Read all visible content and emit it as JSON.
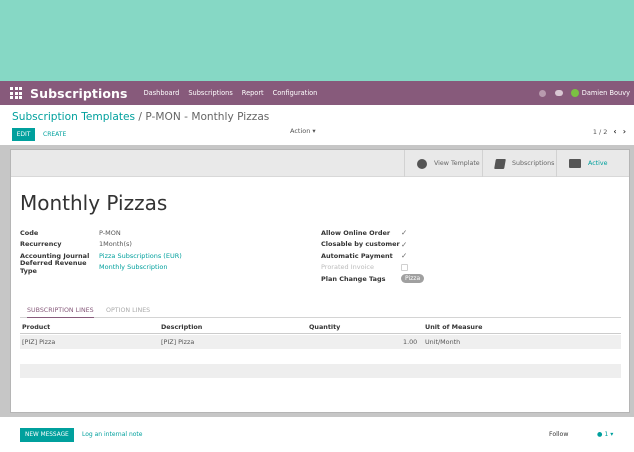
{
  "navbar": {
    "brand": "Subscriptions",
    "menu": [
      "Dashboard",
      "Subscriptions",
      "Report",
      "Configuration"
    ],
    "user": "Damien Bouvy",
    "icons": [
      "apps-icon",
      "clock-icon",
      "chat-icon",
      "avatar"
    ],
    "color": "#875a7b"
  },
  "control_panel": {
    "breadcrumb_parent": "Subscription Templates",
    "breadcrumb_sep": " / ",
    "breadcrumb_current": "P-MON - Monthly Pizzas",
    "edit_label": "EDIT",
    "create_label": "CREATE",
    "action_label": "Action ▾",
    "pager": "1 / 2",
    "prev": "‹",
    "next": "›"
  },
  "smart_buttons": {
    "view_template": "View Template",
    "subscriptions": "Subscriptions",
    "active": "Active"
  },
  "form": {
    "title": "Monthly Pizzas",
    "left_fields": [
      {
        "label": "Code",
        "value": "P-MON"
      },
      {
        "label": "Recurrency",
        "value": "1Month(s)"
      },
      {
        "label": "Accounting Journal",
        "value": "Pizza Subscriptions (EUR)"
      },
      {
        "label": "Deferred Revenue Type",
        "value": "Monthly Subscription"
      }
    ],
    "right_fields": {
      "allow_online_order": "Allow Online Order",
      "closable_by_customer": "Closable by customer",
      "automatic_payment": "Automatic Payment",
      "prorated_invoice": "Prorated Invoice",
      "plan_change_tags": "Plan Change Tags",
      "tag": "Pizza"
    }
  },
  "tabs": {
    "lines": "SUBSCRIPTION LINES",
    "options": "OPTION LINES"
  },
  "table": {
    "headers": [
      "Product",
      "Description",
      "Quantity",
      "Unit of Measure"
    ],
    "rows": [
      {
        "product": "[PIZ] Pizza",
        "description": "[PIZ] Pizza",
        "quantity": "1.00",
        "uom": "Unit/Month"
      }
    ]
  },
  "chatter": {
    "new_message": "NEW MESSAGE",
    "log_note": "Log an internal note",
    "follow": "Follow",
    "followers": "1 ▾"
  },
  "colors": {
    "accent": "#00a09d",
    "brand": "#875a7b",
    "top_band": "#86d8c5"
  }
}
